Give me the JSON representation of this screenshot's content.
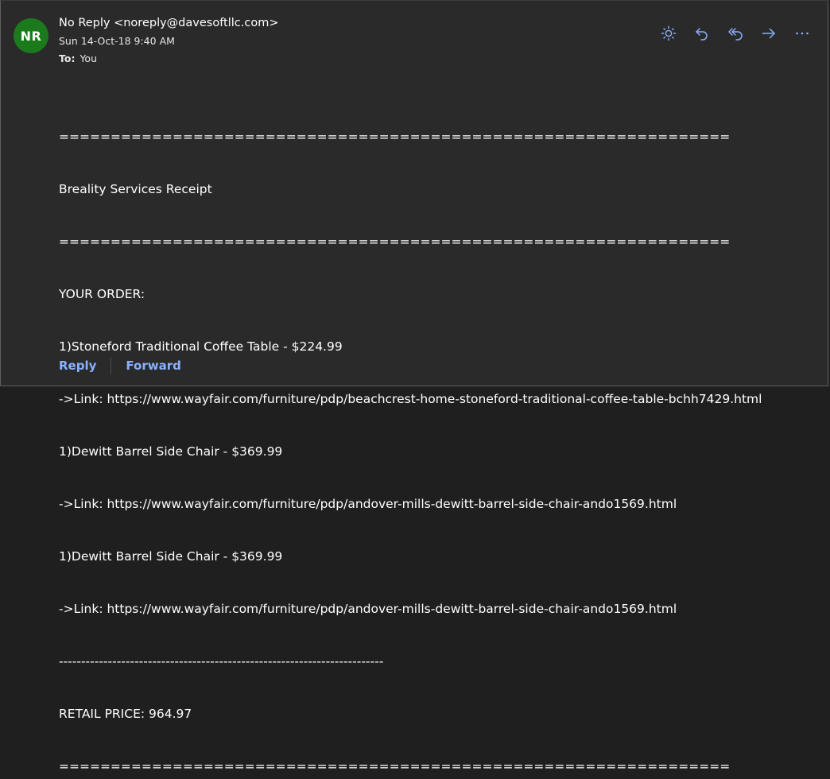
{
  "message": {
    "avatar_initials": "NR",
    "sender": "No Reply <noreply@davesoftllc.com>",
    "date": "Sun 14-Oct-18 9:40 AM",
    "to_label": "To:",
    "to_value": "You"
  },
  "actions": [
    {
      "name": "sun-icon",
      "label": "Immersive reader"
    },
    {
      "name": "reply-icon",
      "label": "Reply"
    },
    {
      "name": "reply-all-icon",
      "label": "Reply all"
    },
    {
      "name": "forward-icon",
      "label": "Forward"
    },
    {
      "name": "more-icon",
      "label": "More actions"
    }
  ],
  "body_lines": [
    "=================================================================",
    "Breality Services Receipt",
    "=================================================================",
    "YOUR ORDER:",
    "1)Stoneford Traditional Coffee Table - $224.99",
    "->Link: https://www.wayfair.com/furniture/pdp/beachcrest-home-stoneford-traditional-coffee-table-bchh7429.html",
    "1)Dewitt Barrel Side Chair - $369.99",
    "->Link: https://www.wayfair.com/furniture/pdp/andover-mills-dewitt-barrel-side-chair-ando1569.html",
    "1)Dewitt Barrel Side Chair - $369.99",
    "->Link: https://www.wayfair.com/furniture/pdp/andover-mills-dewitt-barrel-side-chair-ando1569.html",
    "-------------------------------------------------------------------------",
    "RETAIL PRICE: 964.97",
    "================================================================="
  ],
  "footer": {
    "reply_label": "Reply",
    "forward_label": "Forward"
  },
  "colors": {
    "accent": "#8ab0ff",
    "avatar_bg": "#1b7a1b",
    "background": "#2a2a2a"
  }
}
